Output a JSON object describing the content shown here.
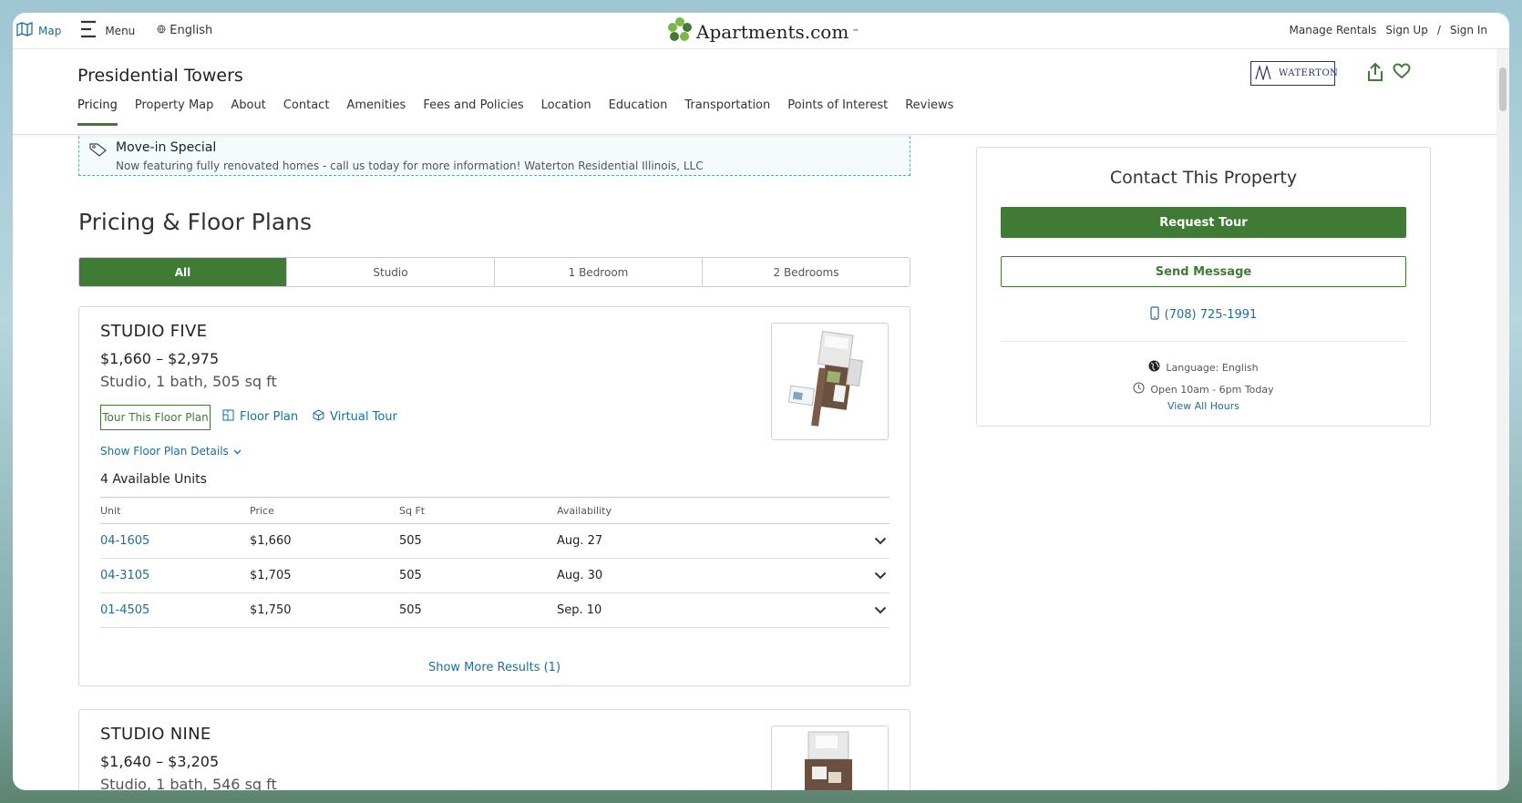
{
  "topnav": {
    "map_label": "Map",
    "menu_label": "Menu",
    "language_label": "English",
    "logo_text": "Apartments.com",
    "logo_tm": "™",
    "manage_rentals": "Manage Rentals",
    "sign_up": "Sign Up",
    "separator": "/",
    "sign_in": "Sign In"
  },
  "property": {
    "title": "Presidential Towers",
    "brand_logo_text": "WATERTON",
    "tabs": [
      {
        "label": "Pricing",
        "active": true
      },
      {
        "label": "Property Map"
      },
      {
        "label": "About"
      },
      {
        "label": "Contact"
      },
      {
        "label": "Amenities"
      },
      {
        "label": "Fees and Policies"
      },
      {
        "label": "Location"
      },
      {
        "label": "Education"
      },
      {
        "label": "Transportation"
      },
      {
        "label": "Points of Interest"
      },
      {
        "label": "Reviews"
      }
    ]
  },
  "special": {
    "title": "Move-in Special",
    "text": "Now featuring fully renovated homes - call us today for more information! Waterton Residential Illinois, LLC"
  },
  "pricing": {
    "title": "Pricing & Floor Plans",
    "filters": [
      "All",
      "Studio",
      "1 Bedroom",
      "2 Bedrooms"
    ],
    "active_filter": "All"
  },
  "plans": [
    {
      "name": "STUDIO FIVE",
      "price": "$1,660 – $2,975",
      "specs": "Studio, 1 bath, 505 sq ft",
      "tour_button": "Tour This Floor Plan",
      "floor_plan_link": "Floor Plan",
      "virtual_tour_link": "Virtual Tour",
      "details_link": "Show Floor Plan Details",
      "units_count": "4 Available Units",
      "table_headers": [
        "Unit",
        "Price",
        "Sq Ft",
        "Availability"
      ],
      "units": [
        {
          "unit": "04-1605",
          "price": "$1,660",
          "sqft": "505",
          "availability": "Aug. 27"
        },
        {
          "unit": "04-3105",
          "price": "$1,705",
          "sqft": "505",
          "availability": "Aug. 30"
        },
        {
          "unit": "01-4505",
          "price": "$1,750",
          "sqft": "505",
          "availability": "Sep. 10"
        }
      ],
      "more_results": "Show More Results (1)"
    },
    {
      "name": "STUDIO NINE",
      "price": "$1,640 – $3,205",
      "specs": "Studio, 1 bath, 546 sq ft"
    }
  ],
  "contact": {
    "title": "Contact This Property",
    "request_tour": "Request Tour",
    "send_message": "Send Message",
    "phone": "(708) 725-1991",
    "language": "Language: English",
    "hours": "Open 10am - 6pm Today",
    "view_all_hours": "View All Hours"
  },
  "colors": {
    "brand_green": "#3f7b35",
    "link_blue": "#1b6e9c",
    "waterton_navy": "#2a2f6d"
  }
}
